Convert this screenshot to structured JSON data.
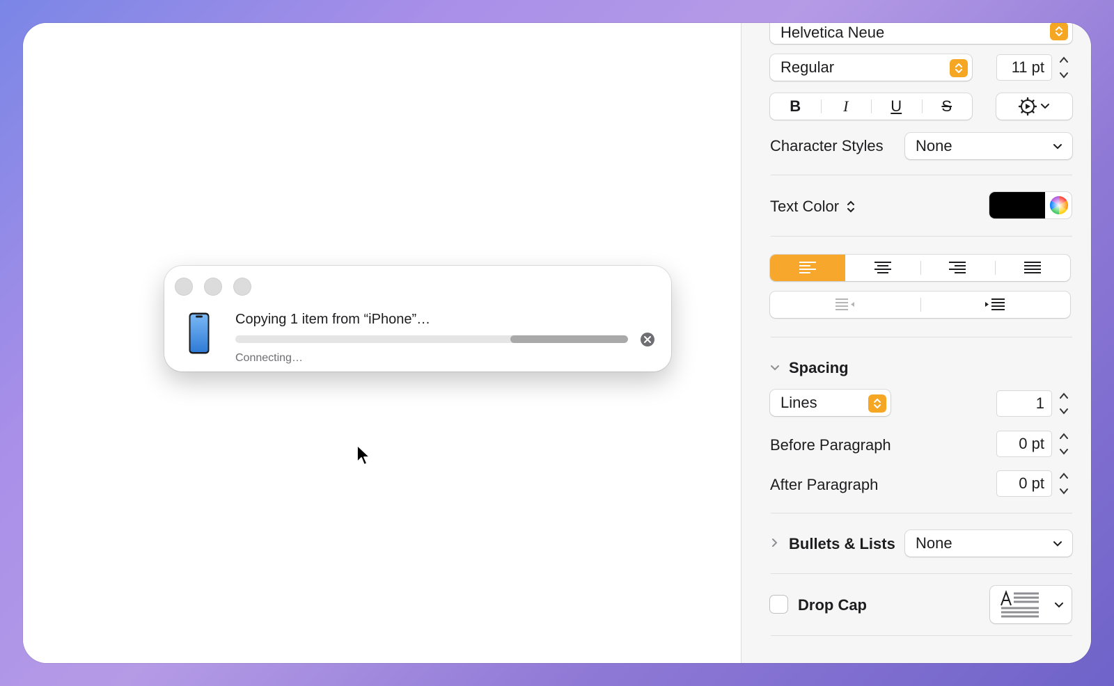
{
  "dialog": {
    "title": "Copying 1 item from “iPhone”…",
    "status": "Connecting…",
    "progress_fraction": 0.3
  },
  "inspector": {
    "font_family": "Helvetica Neue",
    "font_style": "Regular",
    "font_size": "11 pt",
    "style_buttons": {
      "bold": "B",
      "italic": "I",
      "underline": "U",
      "strike": "S"
    },
    "character_styles": {
      "label": "Character Styles",
      "value": "None"
    },
    "text_color": {
      "label": "Text Color",
      "swatch": "#000000"
    },
    "alignment": {
      "selected": "left",
      "accent": "#f7a72b"
    },
    "spacing": {
      "title": "Spacing",
      "mode": "Lines",
      "lines_value": "1",
      "before_label": "Before Paragraph",
      "before_value": "0 pt",
      "after_label": "After Paragraph",
      "after_value": "0 pt"
    },
    "bullets": {
      "title": "Bullets & Lists",
      "value": "None"
    },
    "drop_cap": {
      "label": "Drop Cap",
      "checked": false
    }
  }
}
